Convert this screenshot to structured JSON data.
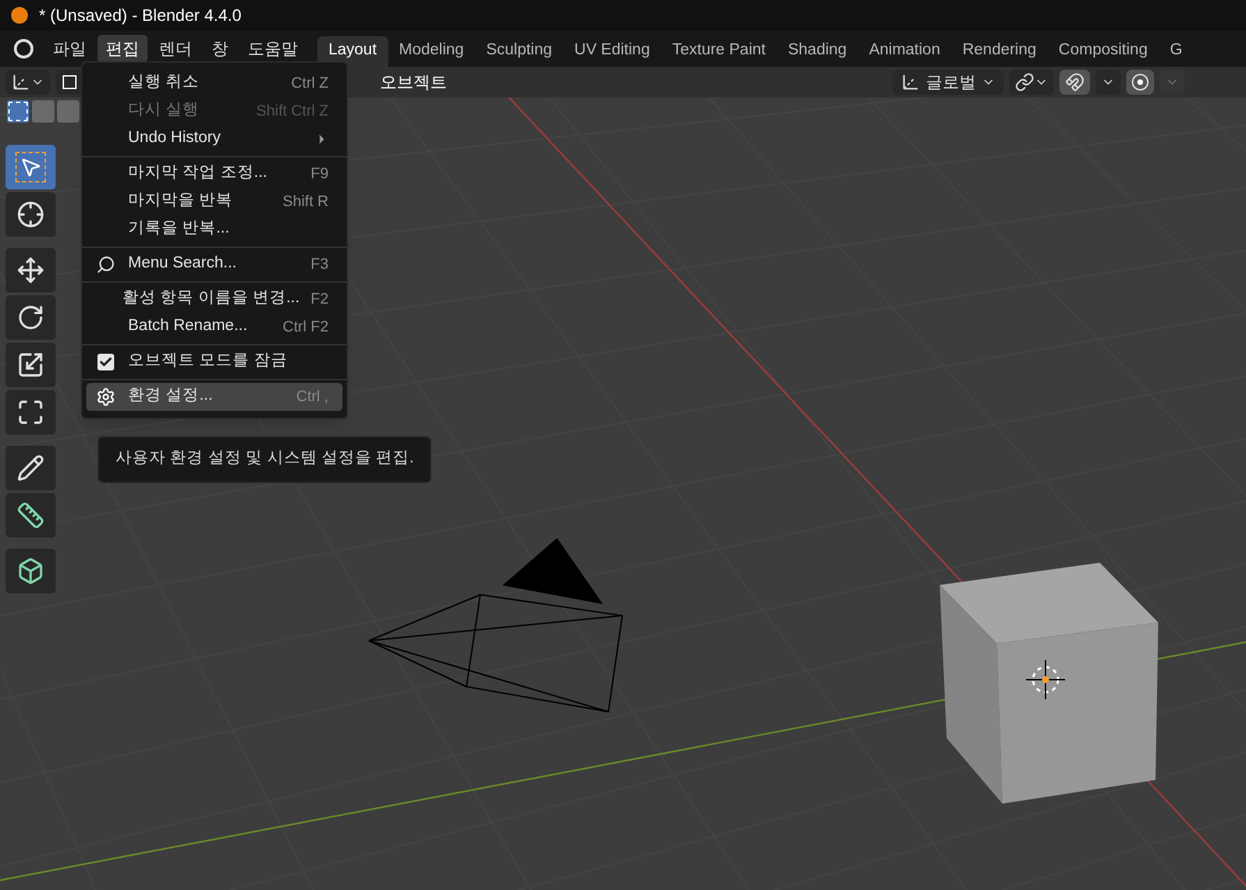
{
  "window": {
    "title": "* (Unsaved) - Blender 4.4.0"
  },
  "menubar": [
    {
      "label": "파일",
      "selected": false
    },
    {
      "label": "편집",
      "selected": true
    },
    {
      "label": "렌더",
      "selected": false
    },
    {
      "label": "창",
      "selected": false
    },
    {
      "label": "도움말",
      "selected": false
    }
  ],
  "workspace_tabs": [
    {
      "label": "Layout",
      "selected": true
    },
    {
      "label": "Modeling",
      "selected": false
    },
    {
      "label": "Sculpting",
      "selected": false
    },
    {
      "label": "UV Editing",
      "selected": false
    },
    {
      "label": "Texture Paint",
      "selected": false
    },
    {
      "label": "Shading",
      "selected": false
    },
    {
      "label": "Animation",
      "selected": false
    },
    {
      "label": "Rendering",
      "selected": false
    },
    {
      "label": "Compositing",
      "selected": false
    },
    {
      "label": "G",
      "selected": false
    }
  ],
  "header": {
    "object_menu": "오브젝트",
    "orientation": "글로벌",
    "select_modes": [
      {
        "selected": true
      },
      {
        "selected": false
      },
      {
        "selected": false
      }
    ]
  },
  "toolbar": {
    "groups": [
      [
        {
          "kind": "select",
          "selected": true
        },
        {
          "kind": "cursor",
          "selected": false
        }
      ],
      [
        {
          "kind": "move",
          "selected": false
        },
        {
          "kind": "rotate",
          "selected": false
        },
        {
          "kind": "scale",
          "selected": false
        },
        {
          "kind": "transform",
          "selected": false
        }
      ],
      [
        {
          "kind": "annotate",
          "selected": false
        },
        {
          "kind": "measure",
          "selected": false
        }
      ],
      [
        {
          "kind": "add_cube",
          "selected": false
        }
      ]
    ]
  },
  "menu": {
    "groups": [
      {
        "items": [
          {
            "label": "실행 취소",
            "shortcut": "Ctrl Z",
            "disabled": false,
            "selected": false
          },
          {
            "label": "다시 실행",
            "shortcut": "Shift Ctrl Z",
            "disabled": true,
            "selected": false
          },
          {
            "label": "Undo History",
            "submenu": true,
            "disabled": false,
            "selected": false
          }
        ]
      },
      {
        "items": [
          {
            "label": "마지막 작업 조정...",
            "shortcut": "F9",
            "disabled": false,
            "selected": false
          },
          {
            "label": "마지막을 반복",
            "shortcut": "Shift R",
            "disabled": false,
            "selected": false
          },
          {
            "label": "기록을 반복...",
            "disabled": false,
            "selected": false
          }
        ]
      },
      {
        "items": [
          {
            "label": "Menu Search...",
            "shortcut": "F3",
            "kind": "search",
            "disabled": false,
            "selected": false
          }
        ]
      },
      {
        "items": [
          {
            "label": "활성 항목 이름을 변경...",
            "shortcut": "F2",
            "disabled": false,
            "selected": false
          },
          {
            "label": "Batch Rename...",
            "shortcut": "Ctrl F2",
            "disabled": false,
            "selected": false
          }
        ]
      },
      {
        "items": [
          {
            "label": "오브젝트 모드를 잠금",
            "kind": "checkbox",
            "checked": true,
            "disabled": false,
            "selected": false
          }
        ]
      },
      {
        "items": [
          {
            "label": "환경 설정...",
            "shortcut": "Ctrl ,",
            "kind": "gear",
            "disabled": false,
            "selected": true
          }
        ]
      }
    ]
  },
  "tooltip": "사용자 환경 설정 및 시스템 설정을 편집."
}
